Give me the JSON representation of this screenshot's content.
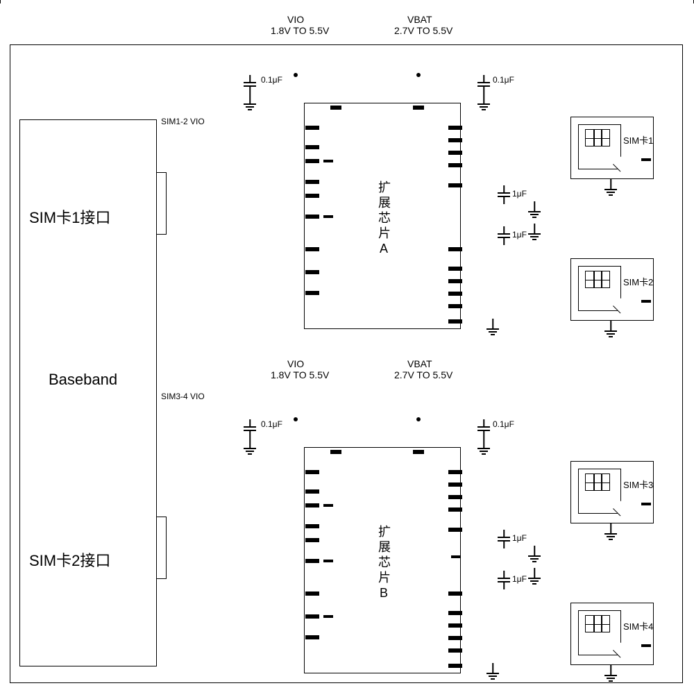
{
  "baseband": {
    "title": "Baseband",
    "sim1_interface": "SIM卡1接口",
    "sim2_interface": "SIM卡2接口"
  },
  "power": {
    "vio_label": "VIO",
    "vio_range": "1.8V TO 5.5V",
    "vbat_label": "VBAT",
    "vbat_range": "2.7V TO 5.5V"
  },
  "caps": {
    "c_small": "0.1μF",
    "c_large": "1μF"
  },
  "signals": {
    "sim12_vio": "SIM1-2 VIO",
    "sim34_vio": "SIM3-4 VIO"
  },
  "chips": {
    "chip_a": "扩展芯片A",
    "chip_b": "扩展芯片B"
  },
  "sims": {
    "sim1": "SIM卡1",
    "sim2": "SIM卡2",
    "sim3": "SIM卡3",
    "sim4": "SIM卡4"
  }
}
